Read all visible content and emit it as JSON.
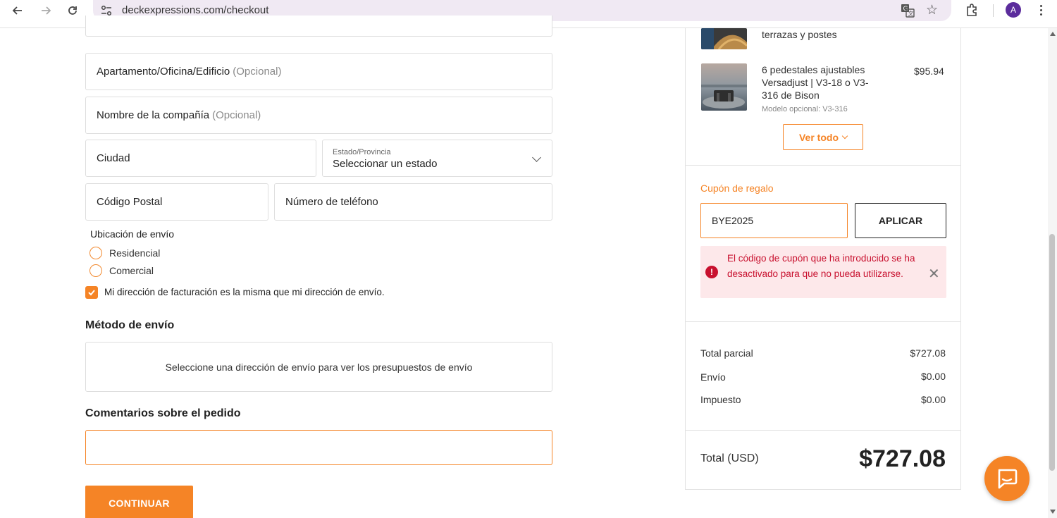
{
  "browser": {
    "url": "deckexpressions.com/checkout",
    "profile_initial": "A"
  },
  "form": {
    "apartment": {
      "label": "Apartamento/Oficina/Edificio",
      "optional": "(Opcional)"
    },
    "company": {
      "label": "Nombre de la compañía",
      "optional": "(Opcional)"
    },
    "city": {
      "label": "Ciudad"
    },
    "state": {
      "small_label": "Estado/Provincia",
      "value": "Seleccionar un estado"
    },
    "postal": {
      "label": "Código Postal"
    },
    "phone": {
      "label": "Número de teléfono"
    },
    "shipping_location": {
      "label": "Ubicación de envío",
      "options": [
        "Residencial",
        "Comercial"
      ]
    },
    "billing_same": {
      "label": "Mi dirección de facturación es la misma que mi dirección de envío.",
      "checked": true
    },
    "shipping_method": {
      "heading": "Método de envío",
      "message": "Seleccione una dirección de envío para ver los presupuestos de envío"
    },
    "comments": {
      "heading": "Comentarios sobre el pedido",
      "value": ""
    },
    "continue_label": "CONTINUAR"
  },
  "summary": {
    "items": [
      {
        "title_partial": "terrazas y postes"
      },
      {
        "title": "6 pedestales ajustables Versadjust | V3-18 o V3-316 de Bison",
        "subtitle": "Modelo opcional: V3-316",
        "price": "$95.94"
      }
    ],
    "view_all_label": "Ver todo",
    "coupon": {
      "label": "Cupón de regalo",
      "value": "BYE2025",
      "apply_label": "APLICAR",
      "error": "El código de cupón que ha introducido se ha desactivado para que no pueda utilizarse."
    },
    "subtotal": {
      "label": "Total parcial",
      "value": "$727.08"
    },
    "shipping": {
      "label": "Envío",
      "value": "$0.00"
    },
    "tax": {
      "label": "Impuesto",
      "value": "$0.00"
    },
    "total": {
      "label": "Total (USD)",
      "value": "$727.08"
    }
  },
  "colors": {
    "accent": "#f58426",
    "error_text": "#c8102e",
    "error_bg": "#fde8ea",
    "urlbar_bg": "#f0e9f3",
    "avatar_bg": "#5b2c9c"
  },
  "icons": [
    "back-icon",
    "forward-icon",
    "reload-icon",
    "site-settings-icon",
    "translate-icon",
    "star-icon",
    "extensions-icon",
    "menu-icon",
    "chevron-down-icon",
    "error-icon",
    "close-icon",
    "chat-icon"
  ]
}
